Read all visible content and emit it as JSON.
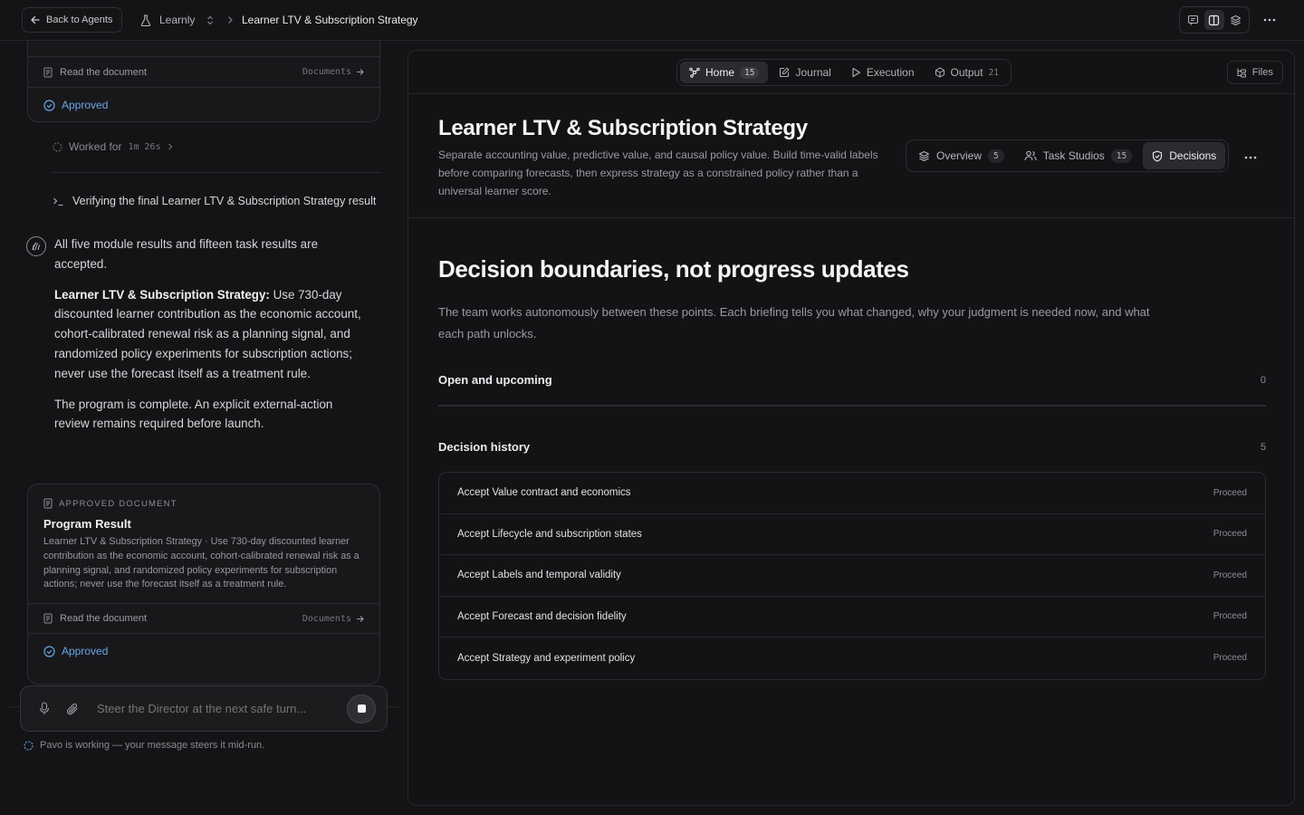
{
  "topbar": {
    "back_label": "Back to Agents",
    "project": "Learnly",
    "page": "Learner LTV & Subscription Strategy"
  },
  "left": {
    "top_card": {
      "read_label": "Read the document",
      "documents_link": "Documents",
      "approved_label": "Approved"
    },
    "worked": {
      "label": "Worked for",
      "duration": "1m 26s"
    },
    "verify_line": "Verifying the final Learner LTV & Subscription Strategy result",
    "message": {
      "p1": "All five module results and fifteen task results are accepted.",
      "p2_bold": "Learner LTV & Subscription Strategy:",
      "p2_rest": " Use 730-day discounted learner contribution as the economic account, cohort-calibrated renewal risk as a planning signal, and randomized policy experiments for subscription actions; never use the forecast itself as a treatment rule.",
      "p3": "The program is complete. An explicit external-action review remains required before launch."
    },
    "doc_card": {
      "kicker": "APPROVED DOCUMENT",
      "title": "Program Result",
      "body": "Learner LTV & Subscription Strategy · Use 730-day discounted learner contribution as the economic account, cohort-calibrated renewal risk as a planning signal, and randomized policy experiments for subscription actions; never use the forecast itself as a treatment rule.",
      "read_label": "Read the document",
      "documents_link": "Documents",
      "approved_label": "Approved"
    },
    "composer": {
      "placeholder": "Steer the Director at the next safe turn..."
    },
    "status": "Pavo is working — your message steers it mid-run."
  },
  "right": {
    "tabs": [
      {
        "label": "Home",
        "count": "15"
      },
      {
        "label": "Journal",
        "count": ""
      },
      {
        "label": "Execution",
        "count": ""
      },
      {
        "label": "Output",
        "count": "21"
      }
    ],
    "files_label": "Files",
    "title": "Learner LTV & Subscription Strategy",
    "description": "Separate accounting value, predictive value, and causal policy value. Build time-valid labels before comparing forecasts, then express strategy as a constrained policy rather than a universal learner score.",
    "subtabs": [
      {
        "label": "Overview",
        "count": "5"
      },
      {
        "label": "Task Studios",
        "count": "15"
      },
      {
        "label": "Decisions",
        "count": ""
      }
    ],
    "heading": "Decision boundaries, not progress updates",
    "intro": "The team works autonomously between these points. Each briefing tells you what changed, why your judgment is needed now, and what each path unlocks.",
    "open": {
      "title": "Open and upcoming",
      "count": "0"
    },
    "history": {
      "title": "Decision history",
      "count": "5"
    },
    "decisions": [
      {
        "label": "Accept Value contract and economics",
        "status": "Proceed"
      },
      {
        "label": "Accept Lifecycle and subscription states",
        "status": "Proceed"
      },
      {
        "label": "Accept Labels and temporal validity",
        "status": "Proceed"
      },
      {
        "label": "Accept Forecast and decision fidelity",
        "status": "Proceed"
      },
      {
        "label": "Accept Strategy and experiment policy",
        "status": "Proceed"
      }
    ]
  }
}
